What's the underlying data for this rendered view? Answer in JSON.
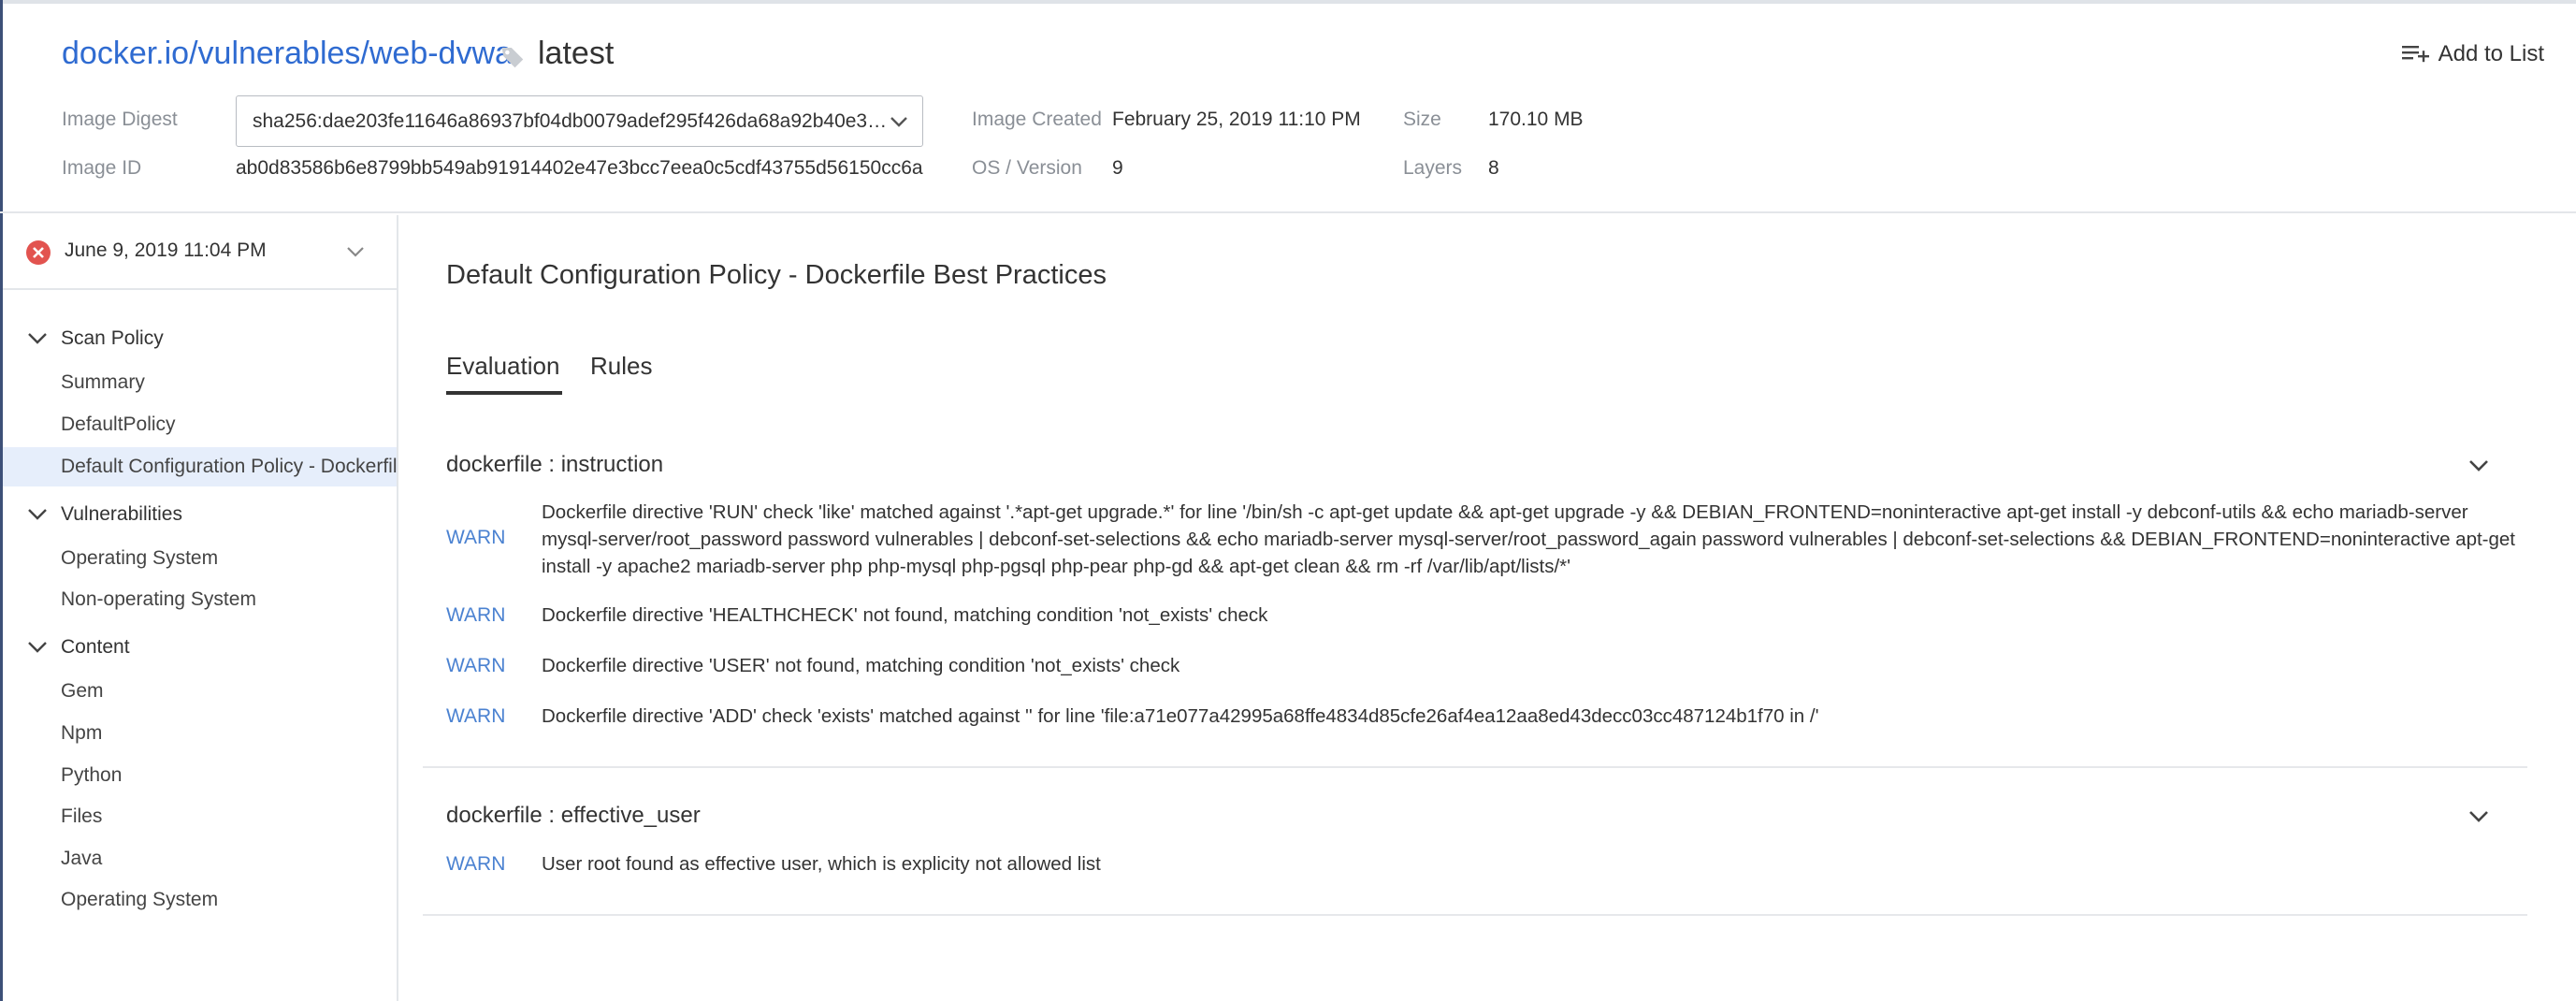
{
  "header": {
    "repo": "docker.io/vulnerables/web-dvwa",
    "tag": "latest",
    "add_to_list": "Add to List",
    "image_digest_label": "Image Digest",
    "image_digest_value": "sha256:dae203fe11646a86937bf04db0079adef295f426da68a92b40e3b...",
    "image_id_label": "Image ID",
    "image_id_value": "ab0d83586b6e8799bb549ab91914402e47e3bcc7eea0c5cdf43755d56150cc6a",
    "image_created_label": "Image Created",
    "image_created_value": "February 25, 2019 11:10 PM",
    "os_version_label": "OS / Version",
    "os_version_value": "9",
    "size_label": "Size",
    "size_value": "170.10 MB",
    "layers_label": "Layers",
    "layers_value": "8"
  },
  "sidebar": {
    "scan_date": "June 9, 2019 11:04 PM",
    "groups": [
      {
        "label": "Scan Policy",
        "items": [
          "Summary",
          "DefaultPolicy",
          "Default Configuration Policy - Dockerfile Best Practices"
        ]
      },
      {
        "label": "Vulnerabilities",
        "items": [
          "Operating System",
          "Non-operating System"
        ]
      },
      {
        "label": "Content",
        "items": [
          "Gem",
          "Npm",
          "Python",
          "Files",
          "Java",
          "Operating System"
        ]
      }
    ]
  },
  "main": {
    "title": "Default Configuration Policy - Dockerfile Best Practices",
    "tabs": [
      "Evaluation",
      "Rules"
    ],
    "sections": [
      {
        "title": "dockerfile : instruction",
        "rows": [
          {
            "level": "WARN",
            "message": "Dockerfile directive 'RUN' check 'like' matched against '.*apt-get upgrade.*' for line '/bin/sh -c apt-get update && apt-get upgrade -y && DEBIAN_FRONTEND=noninteractive apt-get install -y debconf-utils && echo mariadb-server mysql-server/root_password password vulnerables | debconf-set-selections && echo mariadb-server mysql-server/root_password_again password vulnerables | debconf-set-selections && DEBIAN_FRONTEND=noninteractive apt-get install -y apache2 mariadb-server php php-mysql php-pgsql php-pear php-gd && apt-get clean && rm -rf /var/lib/apt/lists/*'"
          },
          {
            "level": "WARN",
            "message": "Dockerfile directive 'HEALTHCHECK' not found, matching condition 'not_exists' check"
          },
          {
            "level": "WARN",
            "message": "Dockerfile directive 'USER' not found, matching condition 'not_exists' check"
          },
          {
            "level": "WARN",
            "message": "Dockerfile directive 'ADD' check 'exists' matched against '' for line 'file:a71e077a42995a68ffe4834d85cfe26af4ea12aa8ed43decc03cc487124b1f70 in /'"
          }
        ]
      },
      {
        "title": "dockerfile : effective_user",
        "rows": [
          {
            "level": "WARN",
            "message": "User root found as effective user, which is explicity not allowed list"
          }
        ]
      }
    ]
  },
  "colors": {
    "link": "#2f6bd1",
    "warn": "#4b82d1",
    "error": "#e2534f",
    "active_bg": "#e6eefb"
  },
  "icons": {
    "tag": "tag-icon",
    "add_list": "playlist-add-icon",
    "error": "error-circle-icon",
    "chevron": "chevron-down-icon"
  }
}
